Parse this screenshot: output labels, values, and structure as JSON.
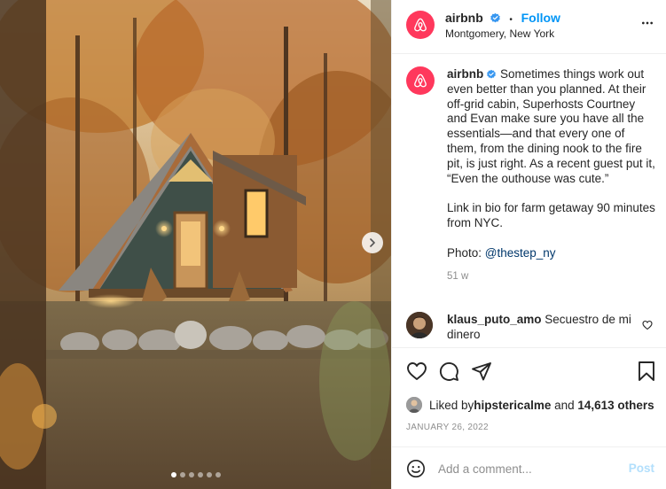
{
  "post": {
    "slides_total": 6,
    "slide_current": 1
  },
  "header": {
    "username": "airbnb",
    "separator": "•",
    "follow_label": "Follow",
    "location": "Montgomery, New York",
    "more_icon": "more-horizontal-icon",
    "avatar_icon": "airbnb-logo-icon",
    "brand_color": "#ff385c"
  },
  "caption": {
    "username": "airbnb",
    "paragraph1": "Sometimes things work out even better than you planned. At their off-grid cabin, Superhosts Courtney and Evan make sure you have all the essentials—and that every one of them, from the dining nook to the fire pit, is just right. As a recent guest put it, “Even the outhouse was cute.”",
    "paragraph2": "Link in bio for farm getaway 90 minutes from NYC.",
    "photo_prefix": "Photo: ",
    "photo_mention": "@thestep_ny",
    "time": "51 w"
  },
  "comment": {
    "username": "klaus_puto_amo",
    "text": "Secuestro de mi dinero"
  },
  "actions": {
    "like_icon": "heart-icon",
    "comment_icon": "comment-icon",
    "share_icon": "send-icon",
    "save_icon": "bookmark-icon"
  },
  "likes": {
    "prefix": "Liked by ",
    "user": "hipstericalme",
    "middle": " and ",
    "count": "14,613 others"
  },
  "date": "JANUARY 26, 2022",
  "add_comment": {
    "placeholder": "Add a comment...",
    "post_label": "Post"
  },
  "colors": {
    "link_blue": "#0095f6",
    "mention": "#00376b",
    "muted": "#8e8e8e",
    "post_disabled": "#b2dffc"
  }
}
